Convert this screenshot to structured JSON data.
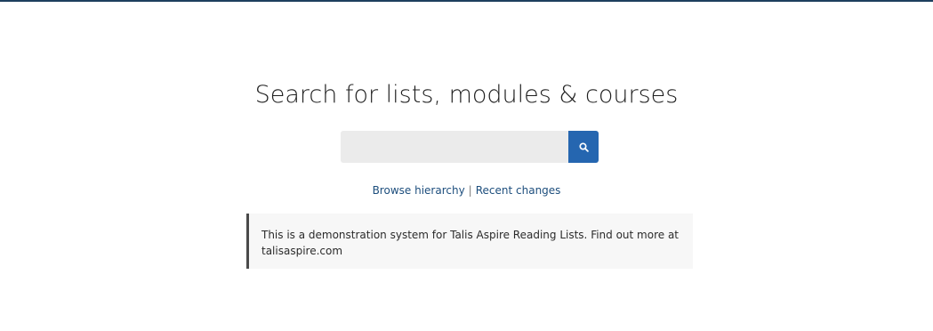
{
  "header": {
    "accent_color": "#1d3f5e"
  },
  "search": {
    "title": "Search for lists, modules & courses",
    "input_value": "",
    "placeholder": "",
    "button_icon": "search-icon",
    "button_color": "#2566b0"
  },
  "nav": {
    "browse_label": "Browse hierarchy",
    "separator": "|",
    "recent_label": "Recent changes"
  },
  "notice": {
    "text": "This is a demonstration system for Talis Aspire Reading Lists. Find out more at talisaspire.com"
  }
}
